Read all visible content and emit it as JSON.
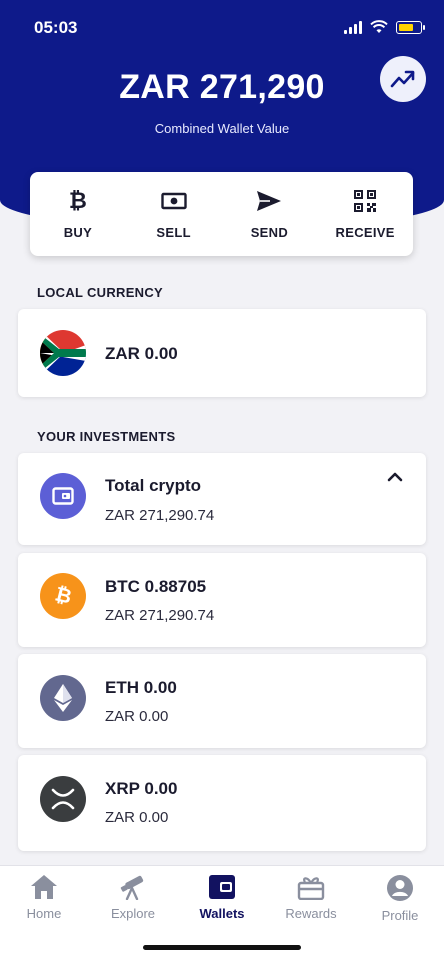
{
  "status_bar": {
    "time": "05:03"
  },
  "header": {
    "total_value": "ZAR 271,290",
    "total_label": "Combined Wallet Value",
    "chart_icon": "trending-up-icon"
  },
  "actions": [
    {
      "label": "BUY",
      "icon": "bitcoin-icon"
    },
    {
      "label": "SELL",
      "icon": "cash-icon"
    },
    {
      "label": "SEND",
      "icon": "send-icon"
    },
    {
      "label": "RECEIVE",
      "icon": "qr-code-icon"
    }
  ],
  "local_currency": {
    "heading": "LOCAL CURRENCY",
    "item": {
      "title": "ZAR 0.00",
      "icon": "south-africa-flag-icon"
    }
  },
  "investments": {
    "heading": "YOUR INVESTMENTS",
    "total": {
      "title": "Total crypto",
      "value": "ZAR 271,290.74",
      "icon": "wallet-icon"
    },
    "items": [
      {
        "title": "BTC 0.88705",
        "value": "ZAR 271,290.74",
        "icon": "bitcoin-coin-icon",
        "color": "#f7931a"
      },
      {
        "title": "ETH 0.00",
        "value": "ZAR 0.00",
        "icon": "ethereum-coin-icon",
        "color": "#62688f"
      },
      {
        "title": "XRP 0.00",
        "value": "ZAR 0.00",
        "icon": "xrp-coin-icon",
        "color": "#3a3d3f"
      }
    ]
  },
  "nav": [
    {
      "label": "Home",
      "icon": "home-icon"
    },
    {
      "label": "Explore",
      "icon": "telescope-icon"
    },
    {
      "label": "Wallets",
      "icon": "wallet-icon",
      "active": true
    },
    {
      "label": "Rewards",
      "icon": "gift-icon"
    },
    {
      "label": "Profile",
      "icon": "profile-icon"
    }
  ],
  "colors": {
    "primary": "#0e1a8a",
    "accent_purple": "#5c5fd6",
    "btc": "#f7931a",
    "eth": "#62688f",
    "xrp": "#3a3d3f"
  }
}
